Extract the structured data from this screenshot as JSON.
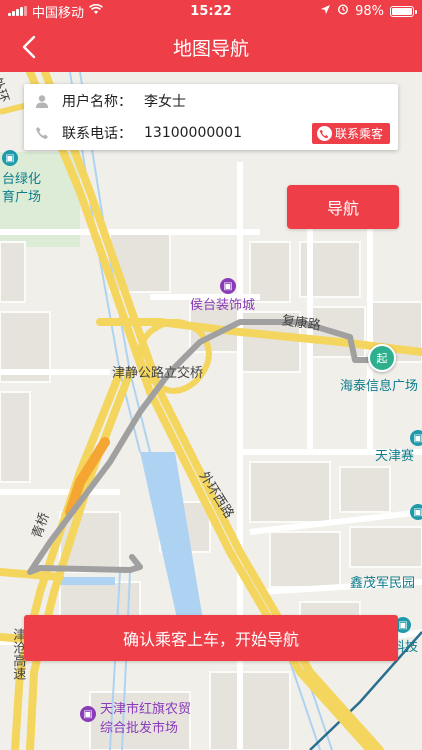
{
  "status_bar": {
    "carrier": "中国移动",
    "time": "15:22",
    "battery_percent": "98%",
    "battery_level": 0.98
  },
  "header": {
    "title": "地图导航",
    "back_icon": "chevron-left-icon"
  },
  "passenger": {
    "name_label": "用户名称：",
    "name_value": "李女士",
    "phone_label": "联系电话：",
    "phone_value": "13100000001",
    "contact_button": "联系乘客"
  },
  "actions": {
    "navigate_label": "导航",
    "confirm_label": "确认乘客上车，开始导航"
  },
  "map": {
    "start_marker": "起",
    "labels": {
      "houtai": "侯台装饰城",
      "jinjing": "津静公路立交桥",
      "haitai": "海泰信息广场",
      "tianjinsai": "天津赛",
      "waihuan": "外环西路",
      "xinmao": "鑫茂军民园",
      "keji": "科技",
      "hongqi1": "天津市红旗农贸",
      "hongqi2": "综合批发市场",
      "tiyu1": "台绿化",
      "tiyu2": "育广场",
      "jinghai": "津沧高速",
      "qingqiao": "青桥",
      "fuxing": "复康路",
      "wai": "外环"
    }
  },
  "colors": {
    "brand_red": "#ee3e48",
    "route_gray": "#a0a0a0",
    "start_green": "#2eb08f"
  }
}
